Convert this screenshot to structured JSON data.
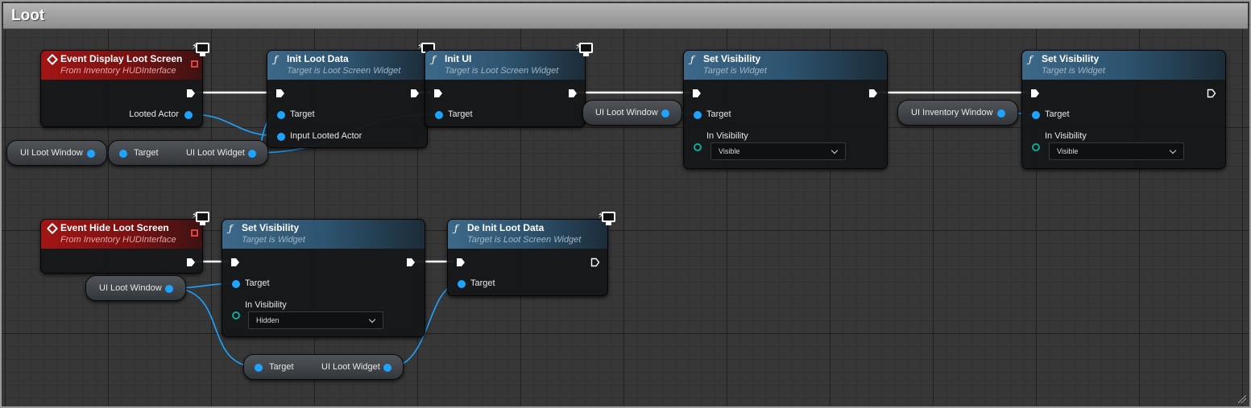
{
  "graph": {
    "comment_title": "Loot",
    "colors": {
      "event_header": "#a31515",
      "function_header": "#3d6888",
      "object_pin": "#1fa3ff",
      "byte_pin": "#13a69b",
      "exec_wire": "#ffffff"
    }
  },
  "nodes": {
    "event_display": {
      "title": "Event Display Loot Screen",
      "subtitle": "From Inventory HUDInterface",
      "output_label": "Looted Actor"
    },
    "init_loot_data": {
      "title": "Init Loot Data",
      "subtitle": "Target is Loot Screen Widget",
      "pin_target": "Target",
      "pin_input": "Input Looted Actor"
    },
    "init_ui": {
      "title": "Init UI",
      "subtitle": "Target is Loot Screen Widget",
      "pin_target": "Target"
    },
    "set_vis_1": {
      "title": "Set Visibility",
      "subtitle": "Target is Widget",
      "pin_target": "Target",
      "pin_vis": "In Visibility",
      "dropdown_value": "Visible"
    },
    "set_vis_2": {
      "title": "Set Visibility",
      "subtitle": "Target is Widget",
      "pin_target": "Target",
      "pin_vis": "In Visibility",
      "dropdown_value": "Visible"
    },
    "event_hide": {
      "title": "Event Hide Loot Screen",
      "subtitle": "From Inventory HUDInterface"
    },
    "set_vis_3": {
      "title": "Set Visibility",
      "subtitle": "Target is Widget",
      "pin_target": "Target",
      "pin_vis": "In Visibility",
      "dropdown_value": "Hidden"
    },
    "deinit_loot_data": {
      "title": "De Init Loot Data",
      "subtitle": "Target is Loot Screen Widget",
      "pin_target": "Target"
    }
  },
  "variables": {
    "ui_loot_window_1": "UI Loot Window",
    "get_loot_widget_1": {
      "target": "Target",
      "output": "UI Loot Widget"
    },
    "ui_loot_window_2": "UI Loot Window",
    "ui_inventory_window": "UI Inventory Window",
    "ui_loot_window_3": "UI Loot Window",
    "get_loot_widget_2": {
      "target": "Target",
      "output": "UI Loot Widget"
    }
  }
}
